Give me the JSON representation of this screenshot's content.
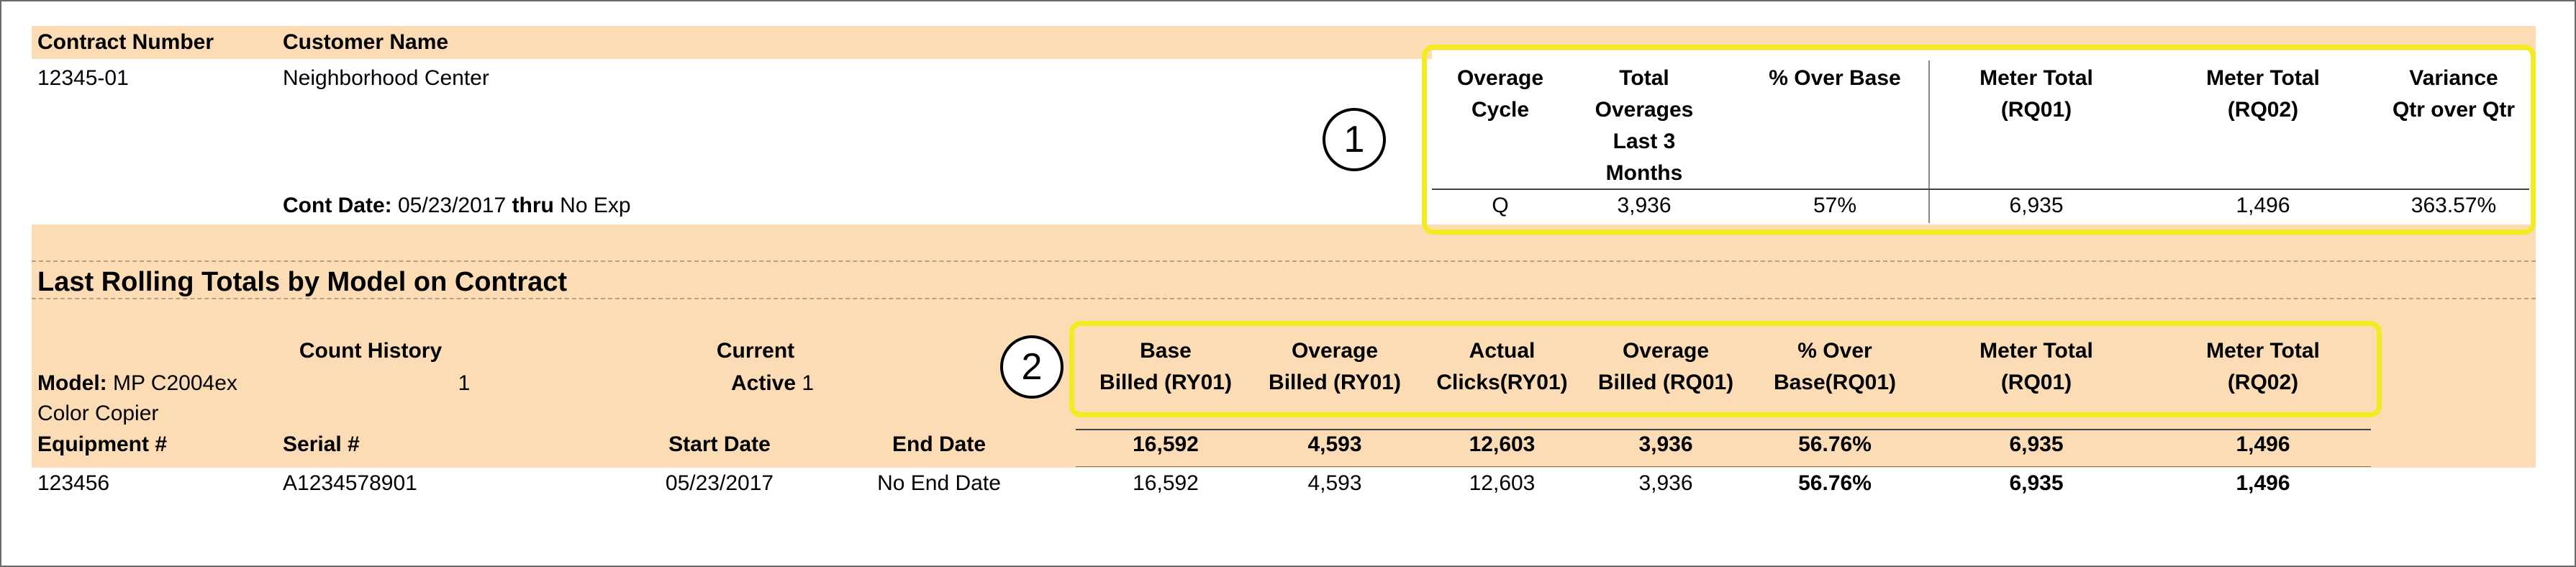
{
  "contract": {
    "header_contract_number": "Contract Number",
    "header_customer_name": "Customer Name",
    "contract_number": "12345-01",
    "customer_name": "Neighborhood Center",
    "cont_date_label": "Cont Date:",
    "cont_date": "05/23/2017",
    "thru_label": "thru",
    "exp": "No Exp"
  },
  "overage_table": {
    "headers": [
      "Overage\nCycle",
      "Total\nOverages\nLast 3\nMonths",
      "% Over Base",
      "Meter Total\n(RQ01)",
      "Meter Total\n(RQ02)",
      "Variance\nQtr over Qtr"
    ],
    "values": [
      "Q",
      "3,936",
      "57%",
      "6,935",
      "1,496",
      "363.57%"
    ]
  },
  "callouts": [
    "1",
    "2"
  ],
  "section_title": "Last Rolling Totals by Model on Contract",
  "model": {
    "model_label": "Model:",
    "model_name": "MP C2004ex",
    "model_desc": "Color Copier",
    "count_history_label": "Count History",
    "count_history_value": "1",
    "current_label": "Current",
    "active_label": "Active",
    "active_value": "1"
  },
  "equipment_headers": {
    "equipment": "Equipment #",
    "serial": "Serial #",
    "start": "Start Date",
    "end": "End Date"
  },
  "billing_table": {
    "headers": [
      "Base\nBilled (RY01)",
      "Overage\nBilled (RY01)",
      "Actual\nClicks(RY01)",
      "Overage\nBilled (RQ01)",
      "% Over\nBase(RQ01)",
      "Meter Total\n(RQ01)",
      "Meter Total\n(RQ02)"
    ],
    "totals": [
      "16,592",
      "4,593",
      "12,603",
      "3,936",
      "56.76%",
      "6,935",
      "1,496"
    ]
  },
  "equipment_row": {
    "equipment": "123456",
    "serial": "A1234578901",
    "start": "05/23/2017",
    "end": "No End Date",
    "values": [
      "16,592",
      "4,593",
      "12,603",
      "3,936",
      "56.76%",
      "6,935",
      "1,496"
    ]
  },
  "colors": {
    "band": "#fcdcb4",
    "highlight": "#f3ea1f"
  }
}
